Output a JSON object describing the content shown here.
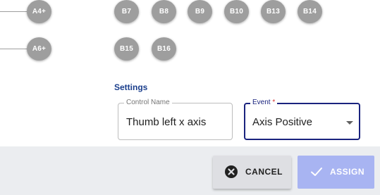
{
  "mapping": {
    "rows": [
      {
        "axis_button": "A4+",
        "buttons": [
          "B7",
          "B8",
          "B9",
          "B10",
          "B13",
          "B14"
        ]
      },
      {
        "axis_button": "A6+",
        "buttons": [
          "B15",
          "B16"
        ]
      }
    ]
  },
  "settings": {
    "title": "Settings",
    "control_name": {
      "label": "Control Name",
      "value": "Thumb left x axis"
    },
    "event": {
      "label": "Event",
      "required_mark": "*",
      "value": "Axis Positive",
      "icon": "chevron-down-icon"
    }
  },
  "actions": {
    "cancel": {
      "label": "CANCEL",
      "icon": "close-circle-icon"
    },
    "assign": {
      "label": "ASSIGN",
      "icon": "check-icon",
      "disabled": true
    }
  },
  "colors": {
    "button_gray": "#9e9e9e",
    "accent_navy": "#1a237e",
    "settings_title": "#1a3e8c",
    "assign_bg": "#a8b4f2",
    "footer_bg": "#ebedf0",
    "required": "#d32f2f"
  }
}
